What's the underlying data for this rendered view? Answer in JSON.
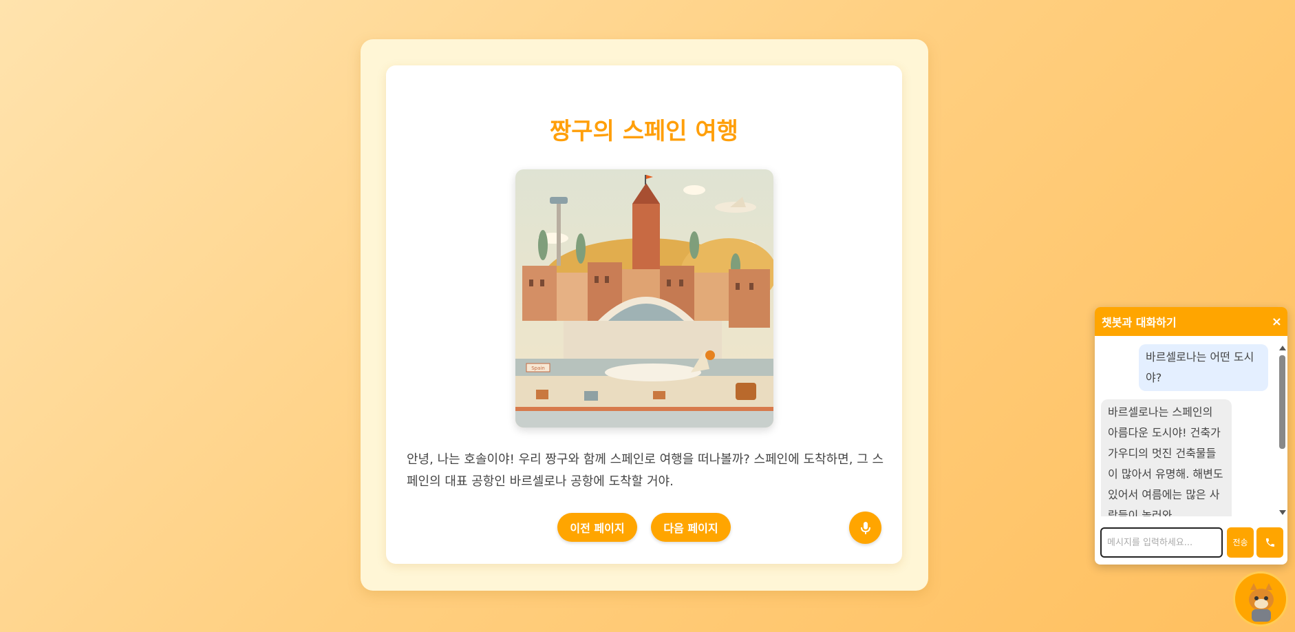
{
  "book": {
    "title": "짱구의 스페인 여행",
    "story": "안녕, 나는 호솔이야! 우리 짱구와 함께 스페인로 여행을 떠나볼까? 스페인에 도착하면, 그 스페인의 대표 공항인 바르셀로나 공항에 도착할 거야.",
    "illustration_sign": "Spain"
  },
  "nav": {
    "prev_label": "이전 페이지",
    "next_label": "다음 페이지"
  },
  "chat": {
    "title": "챗봇과 대화하기",
    "close_label": "×",
    "messages": [
      {
        "role": "user",
        "text": "바르셀로나는 어떤 도시야?"
      },
      {
        "role": "bot",
        "text": "바르셀로나는 스페인의 아름다운 도시야! 건축가 가우디의 멋진 건축물들이 많아서 유명해. 해변도 있어서 여름에는 많은 사람들이 놀러와."
      }
    ],
    "input_placeholder": "메시지를 입력하세요...",
    "send_label": "전송"
  },
  "colors": {
    "accent": "#ffa500",
    "title": "#ff9f0a",
    "user_bubble": "#e4efff",
    "bot_bubble": "#eeeeee"
  },
  "icons": {
    "mic": "microphone-icon",
    "call": "phone-icon",
    "close": "close-icon",
    "avatar": "tiger-character-avatar"
  }
}
